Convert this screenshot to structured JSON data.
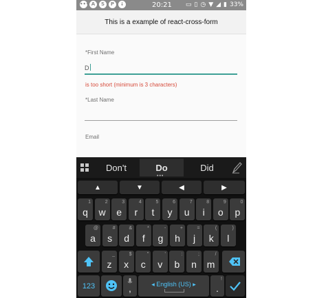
{
  "status_bar": {
    "time": "20:21",
    "battery": "33%",
    "left_icons": [
      "notification-dots-icon",
      "a-icon",
      "skype-icon",
      "pinterest-icon",
      "download-icon"
    ],
    "right_icons": [
      "cast-icon",
      "vibrate-icon",
      "alarm-icon",
      "wifi-icon",
      "signal-icon",
      "battery-icon"
    ]
  },
  "app_bar": {
    "title": "This is a example of react-cross-form"
  },
  "form": {
    "first_name": {
      "label": "*First Name",
      "value": "D",
      "error": "is too short (minimum is 3 characters)"
    },
    "last_name": {
      "label": "*Last Name",
      "value": ""
    },
    "email": {
      "label": "Email"
    }
  },
  "keyboard": {
    "suggestions": [
      "Don't",
      "Do",
      "Did"
    ],
    "arrow_keys": [
      "▲",
      "▼",
      "◀",
      "▶"
    ],
    "row1": [
      {
        "k": "q",
        "h": "1"
      },
      {
        "k": "w",
        "h": "2"
      },
      {
        "k": "e",
        "h": "3"
      },
      {
        "k": "r",
        "h": "4"
      },
      {
        "k": "t",
        "h": "5"
      },
      {
        "k": "y",
        "h": "6"
      },
      {
        "k": "u",
        "h": "7"
      },
      {
        "k": "i",
        "h": "8"
      },
      {
        "k": "o",
        "h": "9"
      },
      {
        "k": "p",
        "h": "0"
      }
    ],
    "row2": [
      {
        "k": "a",
        "h": "@"
      },
      {
        "k": "s",
        "h": "#"
      },
      {
        "k": "d",
        "h": "&"
      },
      {
        "k": "f",
        "h": "*"
      },
      {
        "k": "g",
        "h": "-"
      },
      {
        "k": "h",
        "h": "+"
      },
      {
        "k": "j",
        "h": "="
      },
      {
        "k": "k",
        "h": "("
      },
      {
        "k": "l",
        "h": ")"
      }
    ],
    "row3": [
      {
        "k": "z",
        "h": "_"
      },
      {
        "k": "x",
        "h": "$"
      },
      {
        "k": "c",
        "h": "\""
      },
      {
        "k": "v",
        "h": "'"
      },
      {
        "k": "b",
        "h": ":"
      },
      {
        "k": "n",
        "h": ";"
      },
      {
        "k": "m",
        "h": "/"
      }
    ],
    "symbols_key": "123",
    "comma_key": ",",
    "period_key": ".",
    "period_hint": "!",
    "space_label": "◂ English (US) ▸",
    "accent_color": "#4fc3f7"
  }
}
